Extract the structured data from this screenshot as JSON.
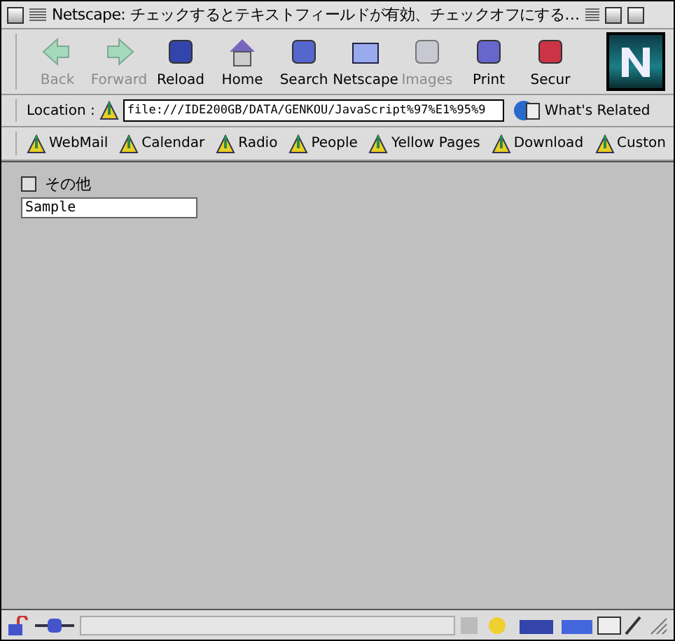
{
  "window": {
    "title": "Netscape: チェックするとテキストフィールドが有効、チェックオフにする…"
  },
  "toolbar": [
    {
      "label": "Back",
      "disabled": true
    },
    {
      "label": "Forward",
      "disabled": true
    },
    {
      "label": "Reload",
      "disabled": false
    },
    {
      "label": "Home",
      "disabled": false
    },
    {
      "label": "Search",
      "disabled": false
    },
    {
      "label": "Netscape",
      "disabled": false
    },
    {
      "label": "Images",
      "disabled": true
    },
    {
      "label": "Print",
      "disabled": false
    },
    {
      "label": "Secur",
      "disabled": false
    }
  ],
  "location": {
    "label": "Location :",
    "value": "file:///IDE200GB/DATA/GENKOU/JavaScript%97%E1%95%9",
    "related": "What's Related"
  },
  "bookmarks": [
    "WebMail",
    "Calendar",
    "Radio",
    "People",
    "Yellow Pages",
    "Download",
    "Custon"
  ],
  "content": {
    "checkbox": {
      "label": "その他",
      "checked": false
    },
    "field": {
      "value": "Sample"
    }
  }
}
